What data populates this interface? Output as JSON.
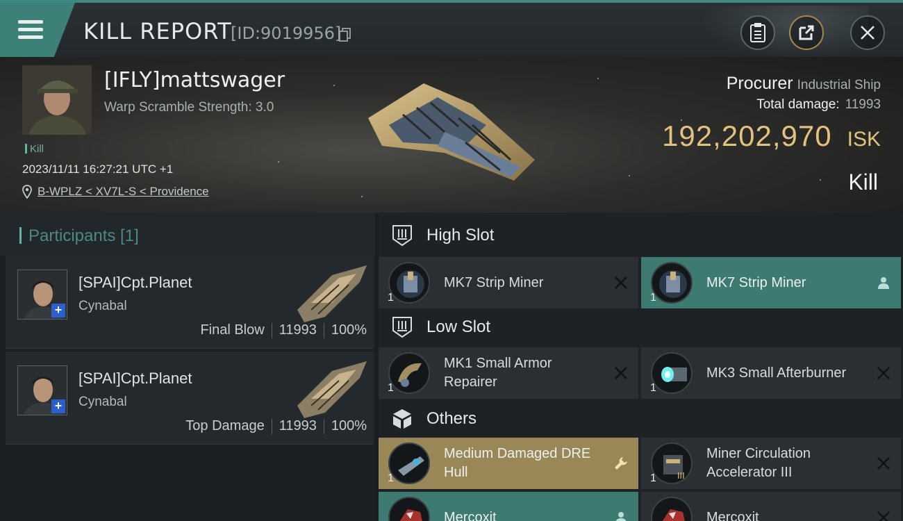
{
  "header": {
    "title": "KILL REPORT",
    "report_id": "[ID:9019956]"
  },
  "victim": {
    "name": "[IFLY]mattswager",
    "subtitle": "Warp Scramble Strength: 3.0",
    "tag": "Kill",
    "timestamp": "2023/11/11 16:27:21 UTC +1",
    "location": "B-WPLZ < XV7L-S < Providence"
  },
  "ship": {
    "name": "Procurer",
    "class": "Industrial Ship",
    "total_damage_label": "Total damage:",
    "total_damage": "11993",
    "isk_value": "192,202,970",
    "isk_unit": "ISK",
    "result": "Kill"
  },
  "participants": {
    "title": "Participants [1]",
    "items": [
      {
        "name": "[SPAI]Cpt.Planet",
        "ship": "Cynabal",
        "label": "Final Blow",
        "damage": "11993",
        "percent": "100%"
      },
      {
        "name": "[SPAI]Cpt.Planet",
        "ship": "Cynabal",
        "label": "Top Damage",
        "damage": "11993",
        "percent": "100%"
      }
    ]
  },
  "fittings": {
    "high_slot": {
      "title": "High Slot",
      "items": [
        {
          "name": "MK7 Strip Miner",
          "qty": "1",
          "state": "destroyed"
        },
        {
          "name": "MK7 Strip Miner",
          "qty": "1",
          "state": "dropped"
        }
      ]
    },
    "low_slot": {
      "title": "Low Slot",
      "items": [
        {
          "name": "MK1 Small Armor Repairer",
          "qty": "1",
          "state": "destroyed"
        },
        {
          "name": "MK3 Small Afterburner",
          "qty": "1",
          "state": "destroyed"
        }
      ]
    },
    "others": {
      "title": "Others",
      "items": [
        {
          "name": "Medium Damaged DRE Hull",
          "qty": "1",
          "state": "salvage"
        },
        {
          "name": "Miner Circulation Accelerator III",
          "qty": "1",
          "state": "destroyed"
        },
        {
          "name": "Mercoxit",
          "qty": "",
          "state": "dropped"
        },
        {
          "name": "Mercoxit",
          "qty": "",
          "state": "destroyed"
        }
      ]
    }
  },
  "colors": {
    "accent_teal": "#3d7a72",
    "isk_gold": "#e3c27f",
    "salvage_gold": "#9a8757",
    "header_teal": "#3d8078"
  },
  "icons": [
    "menu-icon",
    "copy-icon",
    "clipboard-icon",
    "share-icon",
    "close-icon",
    "location-pin-icon",
    "high-slot-icon",
    "low-slot-icon",
    "cube-icon",
    "destroyed-x-icon",
    "person-icon",
    "wrench-icon"
  ]
}
